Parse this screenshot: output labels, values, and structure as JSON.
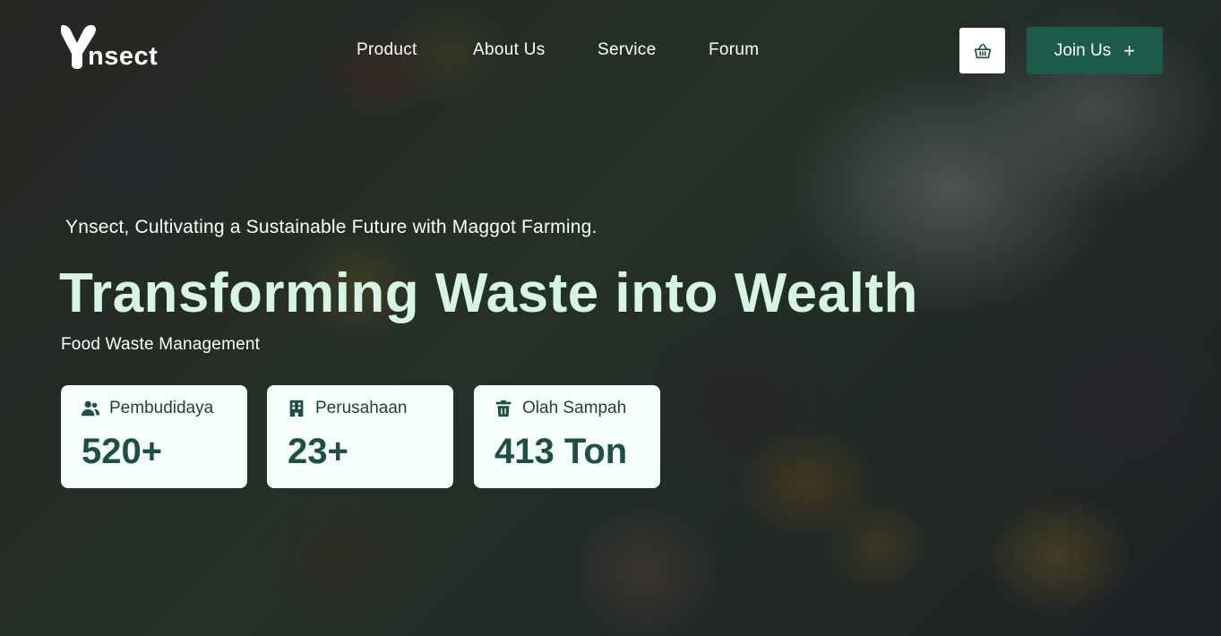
{
  "brand": {
    "logo_text": "nsect",
    "logo_icon": "ynsect-y-mark"
  },
  "nav": {
    "items": [
      {
        "label": "Product"
      },
      {
        "label": "About Us"
      },
      {
        "label": "Service"
      },
      {
        "label": "Forum"
      }
    ]
  },
  "header_actions": {
    "cart_icon": "basket-icon",
    "join_label": "Join Us",
    "join_icon": "plus-icon"
  },
  "hero": {
    "tagline": "Ynsect, Cultivating a Sustainable Future with Maggot Farming.",
    "headline": "Transforming Waste into Wealth",
    "subtitle": "Food Waste Management",
    "background": "food-waste-produce-photo"
  },
  "stats": [
    {
      "icon": "users-icon",
      "label": "Pembudidaya",
      "value": "520+"
    },
    {
      "icon": "building-icon",
      "label": "Perusahaan",
      "value": "23+"
    },
    {
      "icon": "trash-icon",
      "label": "Olah Sampah",
      "value": "413 Ton"
    }
  ],
  "colors": {
    "accent": "#1e5a4c",
    "headline": "#d6f5e5",
    "card_bg": "#f6fefb",
    "card_value": "#1d4f44",
    "overlay": "#141c19"
  }
}
